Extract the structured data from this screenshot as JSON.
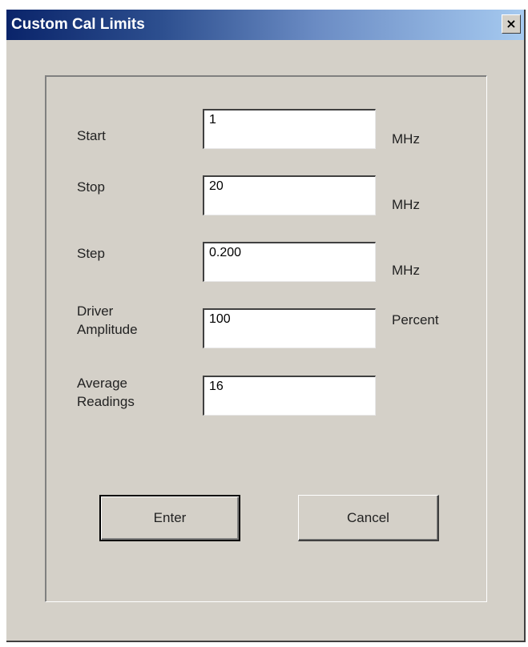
{
  "window": {
    "title": "Custom Cal Limits",
    "close_label": "×"
  },
  "fields": [
    {
      "label": "Start",
      "value": "1",
      "unit": "MHz"
    },
    {
      "label": "Stop",
      "value": "20",
      "unit": "MHz"
    },
    {
      "label": "Step",
      "value": "0.200",
      "unit": "MHz"
    },
    {
      "label": "Driver\nAmplitude",
      "value": "100",
      "unit": "Percent"
    },
    {
      "label": "Average\nReadings",
      "value": "16",
      "unit": ""
    }
  ],
  "buttons": {
    "enter_label": "Enter",
    "cancel_label": "Cancel"
  },
  "colors": {
    "titlebar_start": "#0a246a",
    "titlebar_end": "#a6caf0",
    "face": "#d4d0c8"
  }
}
